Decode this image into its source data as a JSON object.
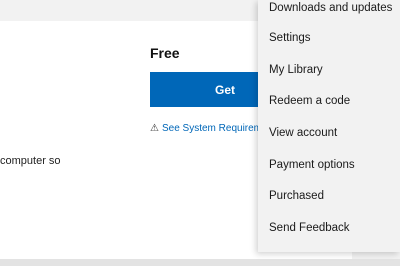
{
  "product": {
    "price": "Free",
    "get_label": "Get",
    "sysreq_icon": "warning-icon",
    "sysreq_label": "See System Requirements",
    "description": "computer so"
  },
  "menu": {
    "items": [
      {
        "label": "Downloads and updates"
      },
      {
        "label": "Settings"
      },
      {
        "label": "My Library"
      },
      {
        "label": "Redeem a code"
      },
      {
        "label": "View account"
      },
      {
        "label": "Payment options"
      },
      {
        "label": "Purchased"
      },
      {
        "label": "Send Feedback"
      }
    ]
  }
}
